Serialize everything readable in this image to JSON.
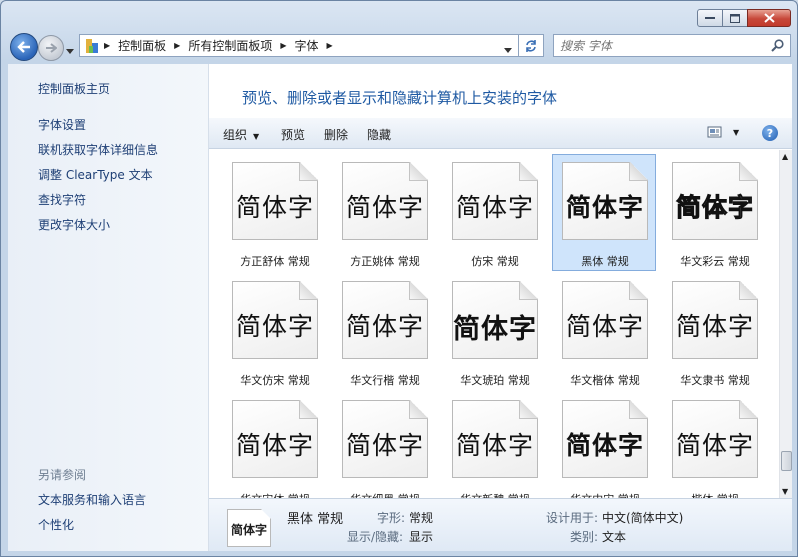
{
  "address": {
    "segments": [
      "控制面板",
      "所有控制面板项",
      "字体"
    ]
  },
  "search": {
    "placeholder": "搜索 字体"
  },
  "sidebar": {
    "home": "控制面板主页",
    "links": [
      "字体设置",
      "联机获取字体详细信息",
      "调整 ClearType 文本",
      "查找字符",
      "更改字体大小"
    ],
    "see_also": "另请参阅",
    "see_also_links": [
      "文本服务和输入语言",
      "个性化"
    ]
  },
  "heading": "预览、删除或者显示和隐藏计算机上安装的字体",
  "toolbar": {
    "organize": "组织",
    "preview": "预览",
    "delete": "删除",
    "hide": "隐藏",
    "help": "?"
  },
  "sample_text": "简体字",
  "fonts": [
    {
      "name": "方正舒体 常规",
      "selected": false
    },
    {
      "name": "方正姚体 常规",
      "selected": false
    },
    {
      "name": "仿宋 常规",
      "selected": false
    },
    {
      "name": "黑体 常规",
      "selected": true
    },
    {
      "name": "华文彩云 常规",
      "selected": false
    },
    {
      "name": "华文仿宋 常规",
      "selected": false
    },
    {
      "name": "华文行楷 常规",
      "selected": false
    },
    {
      "name": "华文琥珀 常规",
      "selected": false
    },
    {
      "name": "华文楷体 常规",
      "selected": false
    },
    {
      "name": "华文隶书 常规",
      "selected": false
    },
    {
      "name": "华文宋体 常规",
      "selected": false
    },
    {
      "name": "华文细黑 常规",
      "selected": false
    },
    {
      "name": "华文新魏 常规",
      "selected": false
    },
    {
      "name": "华文中宋 常规",
      "selected": false
    },
    {
      "name": "楷体 常规",
      "selected": false
    }
  ],
  "details": {
    "name": "黑体 常规",
    "style_label": "字形:",
    "style_value": "常规",
    "visibility_label": "显示/隐藏:",
    "visibility_value": "显示",
    "designed_for_label": "设计用于:",
    "designed_for_value": "中文(简体中文)",
    "category_label": "类别:",
    "category_value": "文本"
  },
  "colors": {
    "link": "#1e3f75",
    "heading": "#1f5aa3",
    "selection": "#cfe4fb"
  }
}
